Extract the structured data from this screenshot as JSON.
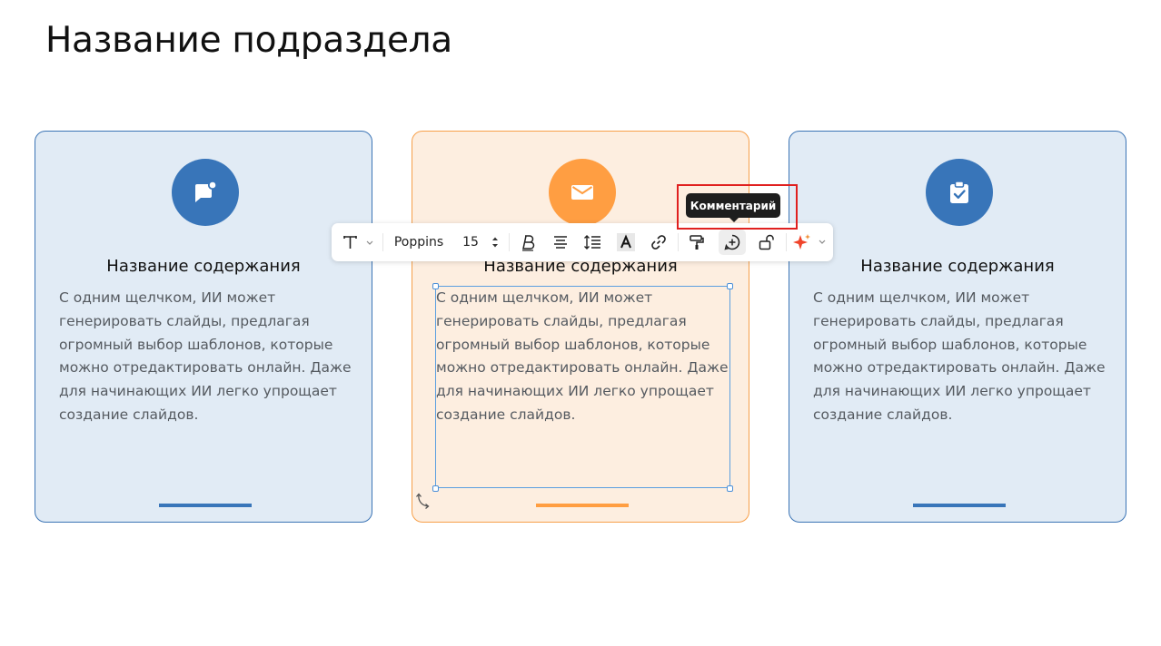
{
  "page": {
    "title": "Название подраздела"
  },
  "cards": [
    {
      "icon": "chat-bubble-icon",
      "title": "Название содержания",
      "body": "С одним щелчком, ИИ может генерировать слайды, предлагая огромный выбор шаблонов, которые можно отредактировать онлайн. Даже для начинающих ИИ легко упрощает создание слайдов.",
      "accent": "#3875b9"
    },
    {
      "icon": "mail-icon",
      "title": "Название содержания",
      "body": "С одним щелчком, ИИ может генерировать слайды, предлагая огромный выбор шаблонов, которые можно отредактировать онлайн. Даже для начинающих ИИ легко упрощает создание слайдов.",
      "accent": "#ff9e42"
    },
    {
      "icon": "clipboard-check-icon",
      "title": "Название содержания",
      "body": "С одним щелчком, ИИ может генерировать слайды, предлагая огромный выбор шаблонов, которые можно отредактировать онлайн. Даже для начинающих ИИ легко упрощает создание слайдов.",
      "accent": "#3875b9"
    }
  ],
  "toolbar": {
    "font_family": "Poppins",
    "font_size": "15",
    "tooltip": "Комментарий",
    "buttons": [
      "text-type",
      "bold",
      "align",
      "line-spacing",
      "text-color",
      "link",
      "format-painter",
      "comment",
      "lock",
      "ai-sparkle"
    ]
  },
  "colors": {
    "blue_accent": "#3875b9",
    "orange_accent": "#ff9e42",
    "selection": "#5b9fe0",
    "highlight": "#e0201f"
  }
}
